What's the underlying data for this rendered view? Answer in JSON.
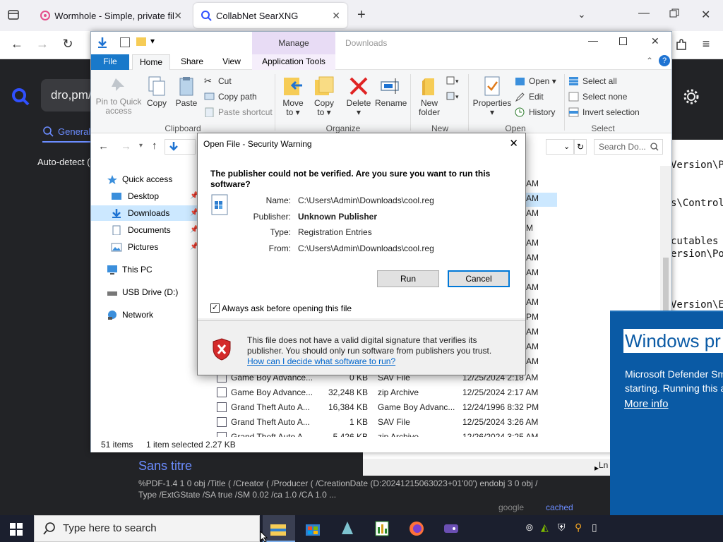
{
  "browser": {
    "tabs": [
      {
        "label": "Wormhole - Simple, private file"
      },
      {
        "label": "CollabNet SearXNG"
      }
    ],
    "new_tab": "+"
  },
  "searxng": {
    "query": "dro,pm/",
    "category": "General",
    "language": "Auto-detect (",
    "result": {
      "title": "Sans titre",
      "snippet_line1": "%PDF-1.4 1 0 obj /Title ( /Creator ( /Producer ( /CreationDate (D:20241215063023+01'00') endobj 3 0 obj /",
      "snippet_line2": "Type /ExtGState /SA true /SM 0.02 /ca 1.0 /CA 1.0 ...",
      "engine": "google",
      "cached": "cached"
    }
  },
  "editor": {
    "lines": [
      "Version\\Po",
      "s\\Control",
      "cutables ",
      "ersion\\Pol",
      "Version\\Ex"
    ],
    "status": "Ln"
  },
  "explorer": {
    "title_manage": "Manage",
    "title_folder": "Downloads",
    "tabs": {
      "file": "File",
      "home": "Home",
      "share": "Share",
      "view": "View",
      "app_tools": "Application Tools"
    },
    "ribbon": {
      "pin": "Pin to Quick access",
      "copy": "Copy",
      "paste": "Paste",
      "cut": "Cut",
      "copy_path": "Copy path",
      "paste_shortcut": "Paste shortcut",
      "move_to": "Move to",
      "copy_to": "Copy to",
      "delete": "Delete",
      "rename": "Rename",
      "new_folder": "New folder",
      "properties": "Properties",
      "open": "Open",
      "edit": "Edit",
      "history": "History",
      "select_all": "Select all",
      "select_none": "Select none",
      "invert_selection": "Invert selection",
      "groups": {
        "clipboard": "Clipboard",
        "organize": "Organize",
        "new": "New",
        "open": "Open",
        "select": "Select"
      }
    },
    "search_placeholder": "Search Do...",
    "nav": {
      "quick_access": "Quick access",
      "desktop": "Desktop",
      "downloads": "Downloads",
      "documents": "Documents",
      "pictures": "Pictures",
      "this_pc": "This PC",
      "usb": "USB Drive (D:)",
      "network": "Network"
    },
    "time_fragments": [
      "AM",
      "AM",
      "AM",
      "M",
      "AM",
      "AM",
      "AM",
      "AM",
      "AM",
      "PM",
      "AM",
      "AM",
      "AM"
    ],
    "files": [
      {
        "name": "Game Boy Advance...",
        "size": "0 KB",
        "type": "SAV File",
        "date": "12/25/2024 2:18 AM"
      },
      {
        "name": "Game Boy Advance...",
        "size": "32,248 KB",
        "type": "zip Archive",
        "date": "12/25/2024 2:17 AM"
      },
      {
        "name": "Grand Theft Auto A...",
        "size": "16,384 KB",
        "type": "Game Boy Advanc...",
        "date": "12/24/1996 8:32 PM"
      },
      {
        "name": "Grand Theft Auto A...",
        "size": "1 KB",
        "type": "SAV File",
        "date": "12/25/2024 3:26 AM"
      },
      {
        "name": "Grand Theft Auto A...",
        "size": "5,426 KB",
        "type": "zip Archive",
        "date": "12/26/2024 3:25 AM"
      }
    ],
    "status": {
      "items": "51 items",
      "selected": "1 item selected  2.27 KB"
    }
  },
  "dialog": {
    "title": "Open File - Security Warning",
    "question": "The publisher could not be verified.  Are you sure you want to run this software?",
    "labels": {
      "name": "Name:",
      "publisher": "Publisher:",
      "type": "Type:",
      "from": "From:"
    },
    "values": {
      "name": "C:\\Users\\Admin\\Downloads\\cool.reg",
      "publisher": "Unknown Publisher",
      "type": "Registration Entries",
      "from": "C:\\Users\\Admin\\Downloads\\cool.reg"
    },
    "run": "Run",
    "cancel": "Cancel",
    "checkbox": "Always ask before opening this file",
    "warning": "This file does not have a valid digital signature that verifies its publisher.  You should only run software from publishers you trust.",
    "link": "How can I decide what software to run?"
  },
  "defender": {
    "title": "Windows pr",
    "text_line1": "Microsoft Defender Sm",
    "text_line2": "starting. Running this a",
    "more_info": "More info"
  },
  "taskbar": {
    "search_placeholder": "Type here to search"
  },
  "colors": {
    "accent": "#0078d7",
    "danger": "#d42a2a",
    "defender_blue": "#0a5aa5",
    "manage_tab": "#e8dcf5"
  }
}
